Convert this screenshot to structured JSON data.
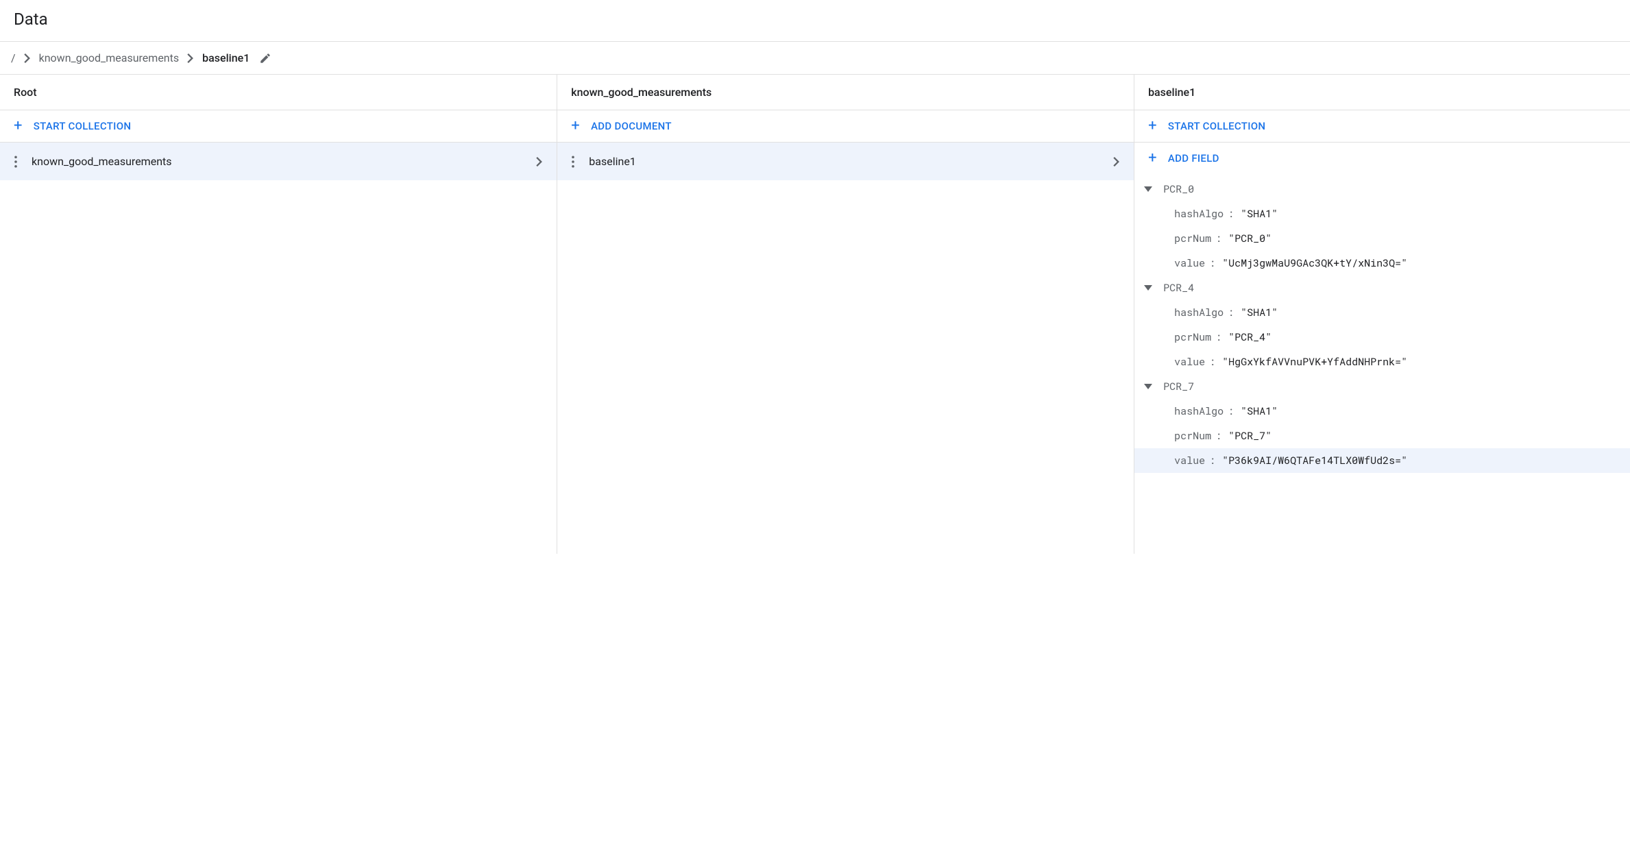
{
  "header": {
    "title": "Data"
  },
  "breadcrumb": {
    "root": "/",
    "collection": "known_good_measurements",
    "document": "baseline1"
  },
  "panels": {
    "root": {
      "title": "Root",
      "action": "START COLLECTION",
      "items": [
        {
          "label": "known_good_measurements",
          "selected": true
        }
      ]
    },
    "collection": {
      "title": "known_good_measurements",
      "action": "ADD DOCUMENT",
      "items": [
        {
          "label": "baseline1",
          "selected": true
        }
      ]
    },
    "document": {
      "title": "baseline1",
      "action_collection": "START COLLECTION",
      "action_field": "ADD FIELD",
      "fields": [
        {
          "name": "PCR_0",
          "props": [
            {
              "key": "hashAlgo",
              "value": "\"SHA1\""
            },
            {
              "key": "pcrNum",
              "value": "\"PCR_0\""
            },
            {
              "key": "value",
              "value": "\"UcMj3gwMaU9GAc3QK+tY/xNin3Q=\""
            }
          ]
        },
        {
          "name": "PCR_4",
          "props": [
            {
              "key": "hashAlgo",
              "value": "\"SHA1\""
            },
            {
              "key": "pcrNum",
              "value": "\"PCR_4\""
            },
            {
              "key": "value",
              "value": "\"HgGxYkfAVVnuPVK+YfAddNHPrnk=\""
            }
          ]
        },
        {
          "name": "PCR_7",
          "props": [
            {
              "key": "hashAlgo",
              "value": "\"SHA1\""
            },
            {
              "key": "pcrNum",
              "value": "\"PCR_7\""
            },
            {
              "key": "value",
              "value": "\"P36k9AI/W6QTAFe14TLX0WfUd2s=\"",
              "highlight": true
            }
          ]
        }
      ]
    }
  }
}
